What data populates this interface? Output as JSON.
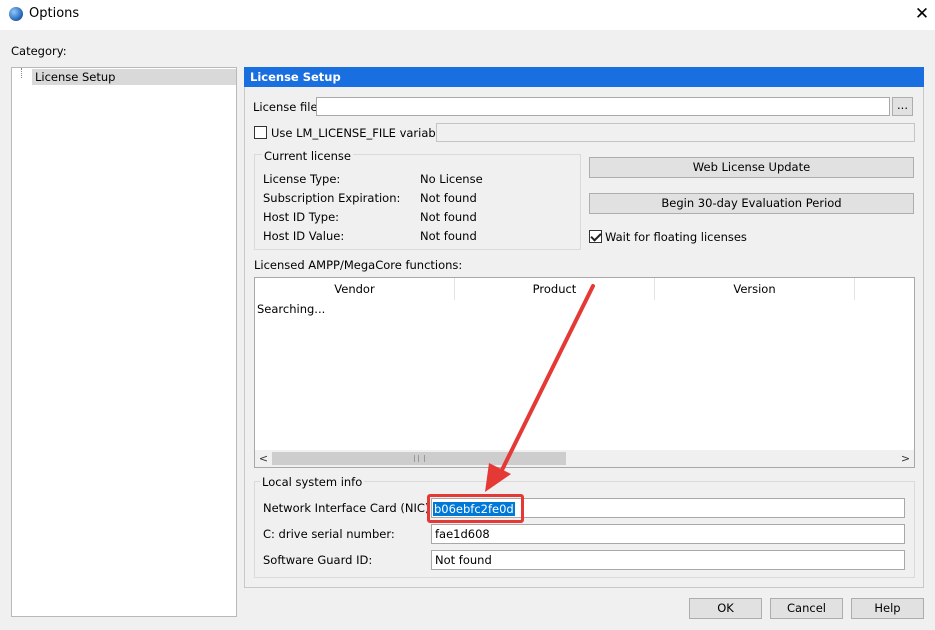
{
  "window": {
    "title": "Options",
    "close_symbol": "✕"
  },
  "category": {
    "label": "Category:",
    "items": [
      "License Setup"
    ]
  },
  "panel": {
    "header": "License Setup",
    "license_file": {
      "label": "License file:",
      "value": "",
      "browse_label": "..."
    },
    "use_env": {
      "label": "Use LM_LICENSE_FILE variable:",
      "checked": false,
      "value": ""
    },
    "current_license": {
      "title": "Current license",
      "rows": [
        {
          "label": "License Type:",
          "value": "No License"
        },
        {
          "label": "Subscription Expiration:",
          "value": "Not found"
        },
        {
          "label": "Host ID Type:",
          "value": "Not found"
        },
        {
          "label": "Host ID Value:",
          "value": "Not found"
        }
      ]
    },
    "web_license_update": "Web License Update",
    "begin_evaluation": "Begin 30-day Evaluation Period",
    "wait_floating": {
      "label": "Wait for floating licenses",
      "checked": true
    },
    "licensed_functions": {
      "title": "Licensed AMPP/MegaCore functions:",
      "columns": [
        "Vendor",
        "Product",
        "Version"
      ],
      "status": "Searching..."
    },
    "local_system": {
      "title": "Local system info",
      "nic": {
        "label": "Network Interface Card (NIC) ID:",
        "value": "b06ebfc2fe0d"
      },
      "drive": {
        "label": "C: drive serial number:",
        "value": "fae1d608"
      },
      "guard": {
        "label": "Software Guard ID:",
        "value": "Not found"
      }
    }
  },
  "footer": {
    "ok": "OK",
    "cancel": "Cancel",
    "help": "Help"
  },
  "annotation_color": "#e53935",
  "accent_color": "#1a6fe0"
}
